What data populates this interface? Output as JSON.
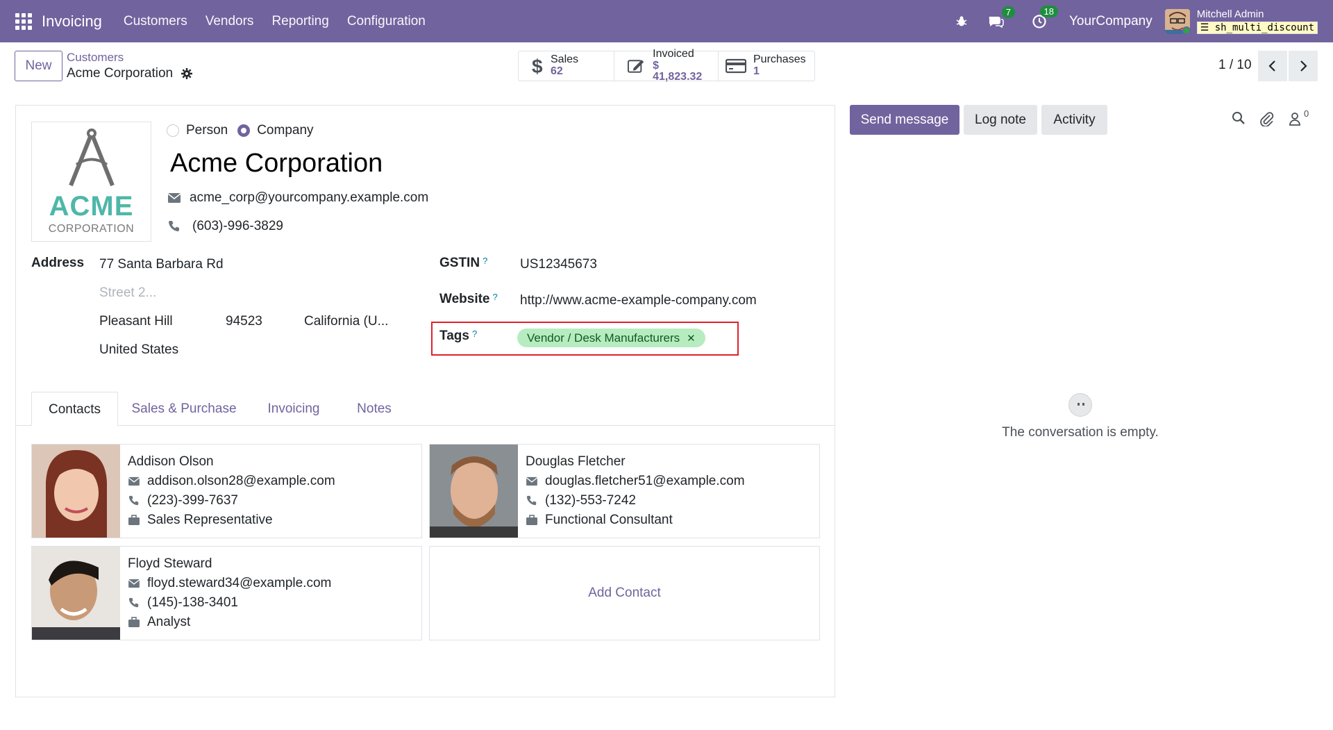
{
  "navbar": {
    "app_name": "Invoicing",
    "menus": [
      "Customers",
      "Vendors",
      "Reporting",
      "Configuration"
    ],
    "messages_badge": "7",
    "activities_badge": "18",
    "company": "YourCompany",
    "user_name": "Mitchell Admin",
    "database": "sh_multi_discount",
    "color": "#71639e"
  },
  "control": {
    "new_label": "New",
    "breadcrumb_parent": "Customers",
    "breadcrumb_current": "Acme Corporation",
    "stats": [
      {
        "label": "Sales",
        "value": "62",
        "icon": "dollar-icon"
      },
      {
        "label": "Invoiced",
        "value": "$ 41,823.32",
        "icon": "edit-invoice-icon"
      },
      {
        "label": "Purchases",
        "value": "1",
        "icon": "credit-card-icon"
      }
    ],
    "pager": "1 / 10"
  },
  "form": {
    "logo_main": "ACME",
    "logo_sub": "CORPORATION",
    "type_person": "Person",
    "type_company": "Company",
    "selected_type": "Company",
    "name": "Acme Corporation",
    "email": "acme_corp@yourcompany.example.com",
    "phone": "(603)-996-3829",
    "address_label": "Address",
    "street": "77 Santa Barbara Rd",
    "street2_placeholder": "Street 2...",
    "city": "Pleasant Hill",
    "zip": "94523",
    "state": "California (U...",
    "country": "United States",
    "gstin_label": "GSTIN",
    "gstin": "US12345673",
    "website_label": "Website",
    "website": "http://www.acme-example-company.com",
    "tags_label": "Tags",
    "tag": "Vendor / Desk Manufacturers",
    "help_mark": "?"
  },
  "tabs": [
    "Contacts",
    "Sales & Purchase",
    "Invoicing",
    "Notes"
  ],
  "contacts": [
    {
      "name": "Addison Olson",
      "email": "addison.olson28@example.com",
      "phone": "(223)-399-7637",
      "title": "Sales Representative"
    },
    {
      "name": "Douglas Fletcher",
      "email": "douglas.fletcher51@example.com",
      "phone": "(132)-553-7242",
      "title": "Functional Consultant"
    },
    {
      "name": "Floyd Steward",
      "email": "floyd.steward34@example.com",
      "phone": "(145)-138-3401",
      "title": "Analyst"
    }
  ],
  "add_contact": "Add Contact",
  "chatter": {
    "send_message": "Send message",
    "log_note": "Log note",
    "activity": "Activity",
    "followers_count": "0",
    "empty_text": "The conversation is empty."
  }
}
